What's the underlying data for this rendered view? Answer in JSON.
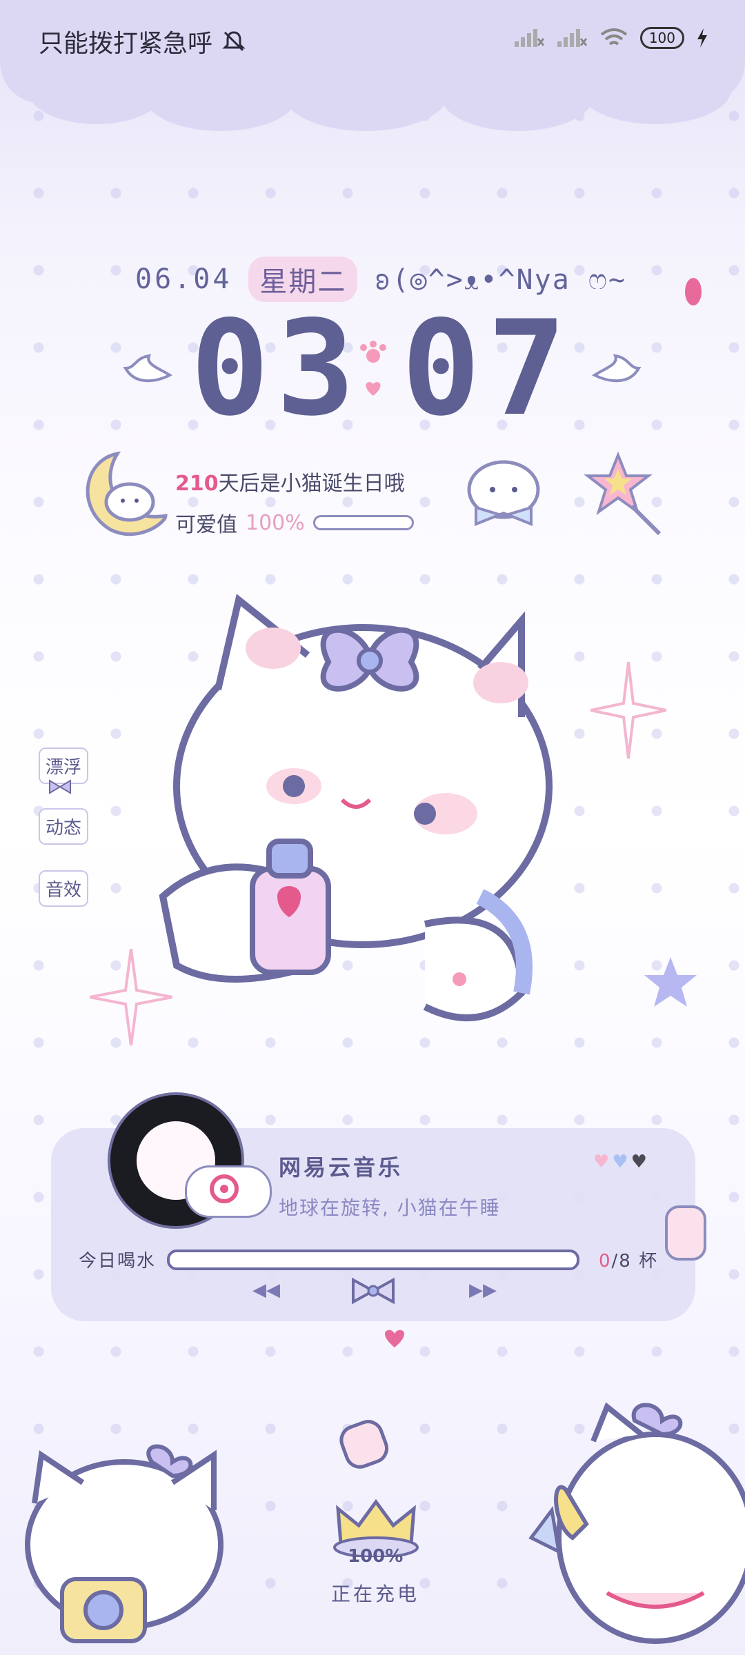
{
  "status_bar": {
    "carrier_text": "只能拨打紧急呼",
    "battery_level": "100",
    "icons": [
      "bell-off-icon",
      "signal-icon",
      "signal-icon",
      "wifi-icon",
      "battery-icon",
      "charging-bolt-icon"
    ]
  },
  "lockscreen": {
    "date": "06.04",
    "weekday": "星期二",
    "kaomoji": "ʚ(◎^>ᴥ•^Nya ෆ~",
    "time_hours": "03",
    "time_minutes": "07",
    "birthday_days": "210",
    "birthday_text": "天后是小猫诞生日哦",
    "cute_label": "可爱值",
    "cute_value": "100%"
  },
  "side_menu": [
    "漂浮",
    "动态",
    "音效"
  ],
  "music_card": {
    "app_name": "网易云音乐",
    "track": "地球在旋转, 小猫在午睡",
    "water_label": "今日喝水",
    "water_current": "0",
    "water_total": "/8 杯",
    "water_progress": 0
  },
  "charging": {
    "percent": "100%",
    "status": "正在充电"
  },
  "colors": {
    "accent": "#5e5f92",
    "pink": "#e45a8d",
    "lavender": "#dcd8f4"
  }
}
